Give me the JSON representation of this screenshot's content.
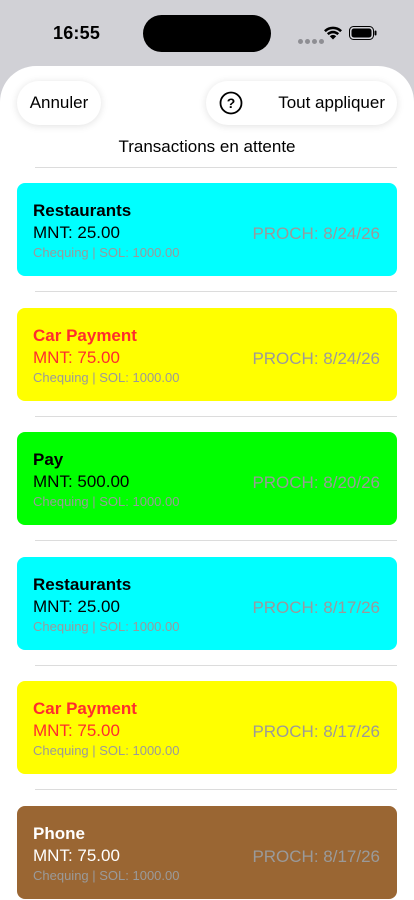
{
  "status_bar": {
    "time": "16:55"
  },
  "header": {
    "cancel_label": "Annuler",
    "help_label": "?",
    "apply_label": "Tout appliquer",
    "title": "Transactions en attente"
  },
  "transactions": [
    {
      "name": "Restaurants",
      "amount": "MNT: 25.00",
      "account": "Chequing | SOL: 1000.00",
      "date": "PROCH: 8/24/26",
      "bg": "#00ffff",
      "text_color": "#000000"
    },
    {
      "name": "Car Payment",
      "amount": "MNT: 75.00",
      "account": "Chequing | SOL: 1000.00",
      "date": "PROCH: 8/24/26",
      "bg": "#ffff00",
      "text_color": "#ff2d2d"
    },
    {
      "name": "Pay",
      "amount": "MNT: 500.00",
      "account": "Chequing | SOL: 1000.00",
      "date": "PROCH: 8/20/26",
      "bg": "#00ff00",
      "text_color": "#000000"
    },
    {
      "name": "Restaurants",
      "amount": "MNT: 25.00",
      "account": "Chequing | SOL: 1000.00",
      "date": "PROCH: 8/17/26",
      "bg": "#00ffff",
      "text_color": "#000000"
    },
    {
      "name": "Car Payment",
      "amount": "MNT: 75.00",
      "account": "Chequing | SOL: 1000.00",
      "date": "PROCH: 8/17/26",
      "bg": "#ffff00",
      "text_color": "#ff2d2d"
    },
    {
      "name": "Phone",
      "amount": "MNT: 75.00",
      "account": "Chequing | SOL: 1000.00",
      "date": "PROCH: 8/17/26",
      "bg": "#9a6633",
      "text_color": "#ffffff"
    }
  ]
}
